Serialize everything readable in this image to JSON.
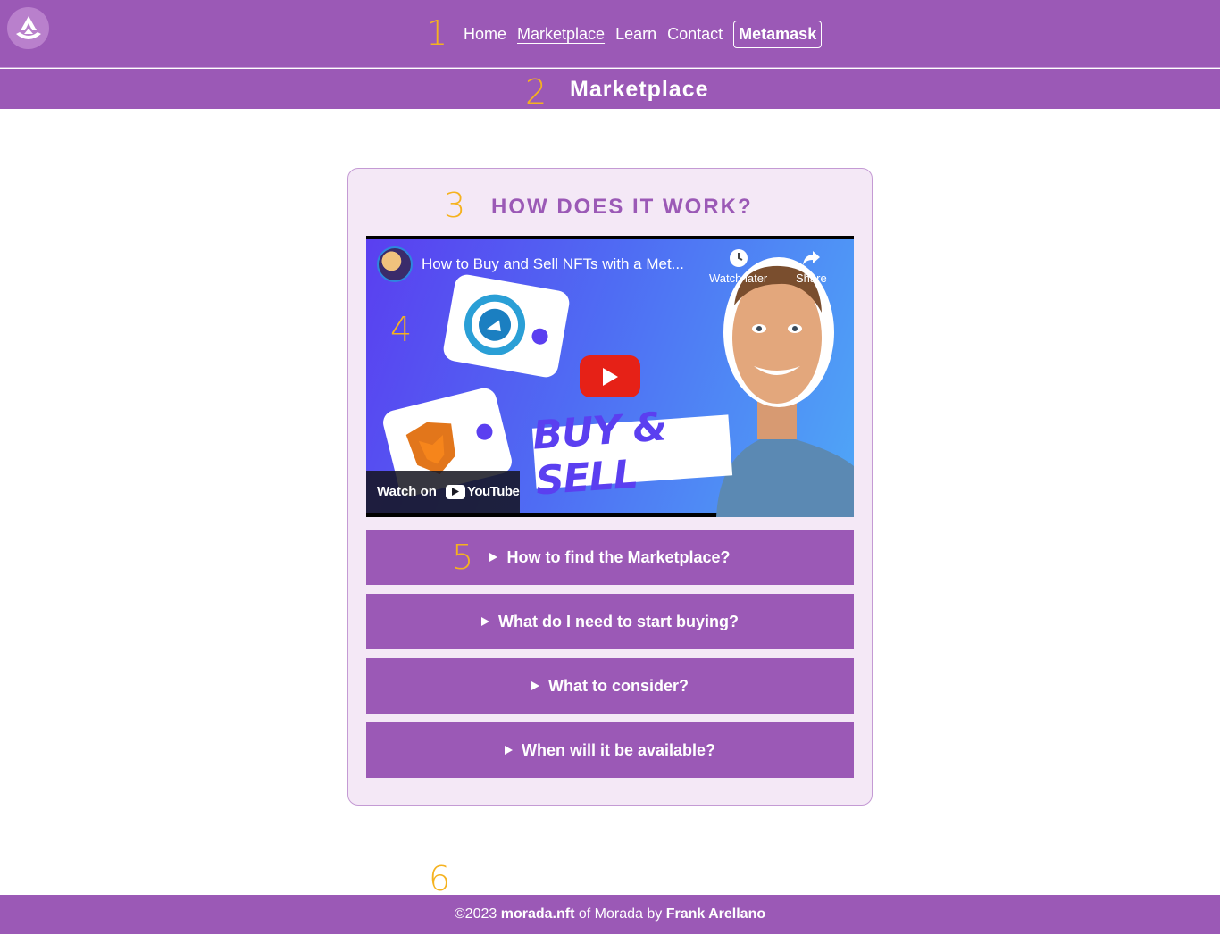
{
  "nav": {
    "links": [
      "Home",
      "Marketplace",
      "Learn",
      "Contact"
    ],
    "active": "Marketplace",
    "wallet_button": "Metamask"
  },
  "annotations": [
    "1",
    "2",
    "3",
    "4",
    "5",
    "6"
  ],
  "page_title": "Marketplace",
  "card": {
    "heading": "HOW DOES IT WORK?",
    "video": {
      "title": "How to Buy and Sell NFTs with a Met...",
      "watch_later": "Watch later",
      "share": "Share",
      "thumbnail_text": "BUY & SELL",
      "watch_on": "Watch on",
      "youtube": "YouTube"
    },
    "faq": [
      "How to find the Marketplace?",
      "What do I need to start buying?",
      "What to consider?",
      "When will it be available?"
    ]
  },
  "footer": {
    "prefix": "©2023",
    "site": "morada.nft",
    "middle": "of Morada by",
    "author": "Frank Arellano"
  },
  "colors": {
    "primary": "#9b59b6",
    "card_bg": "#f4e8f6",
    "annotation": "#f5b21f"
  }
}
